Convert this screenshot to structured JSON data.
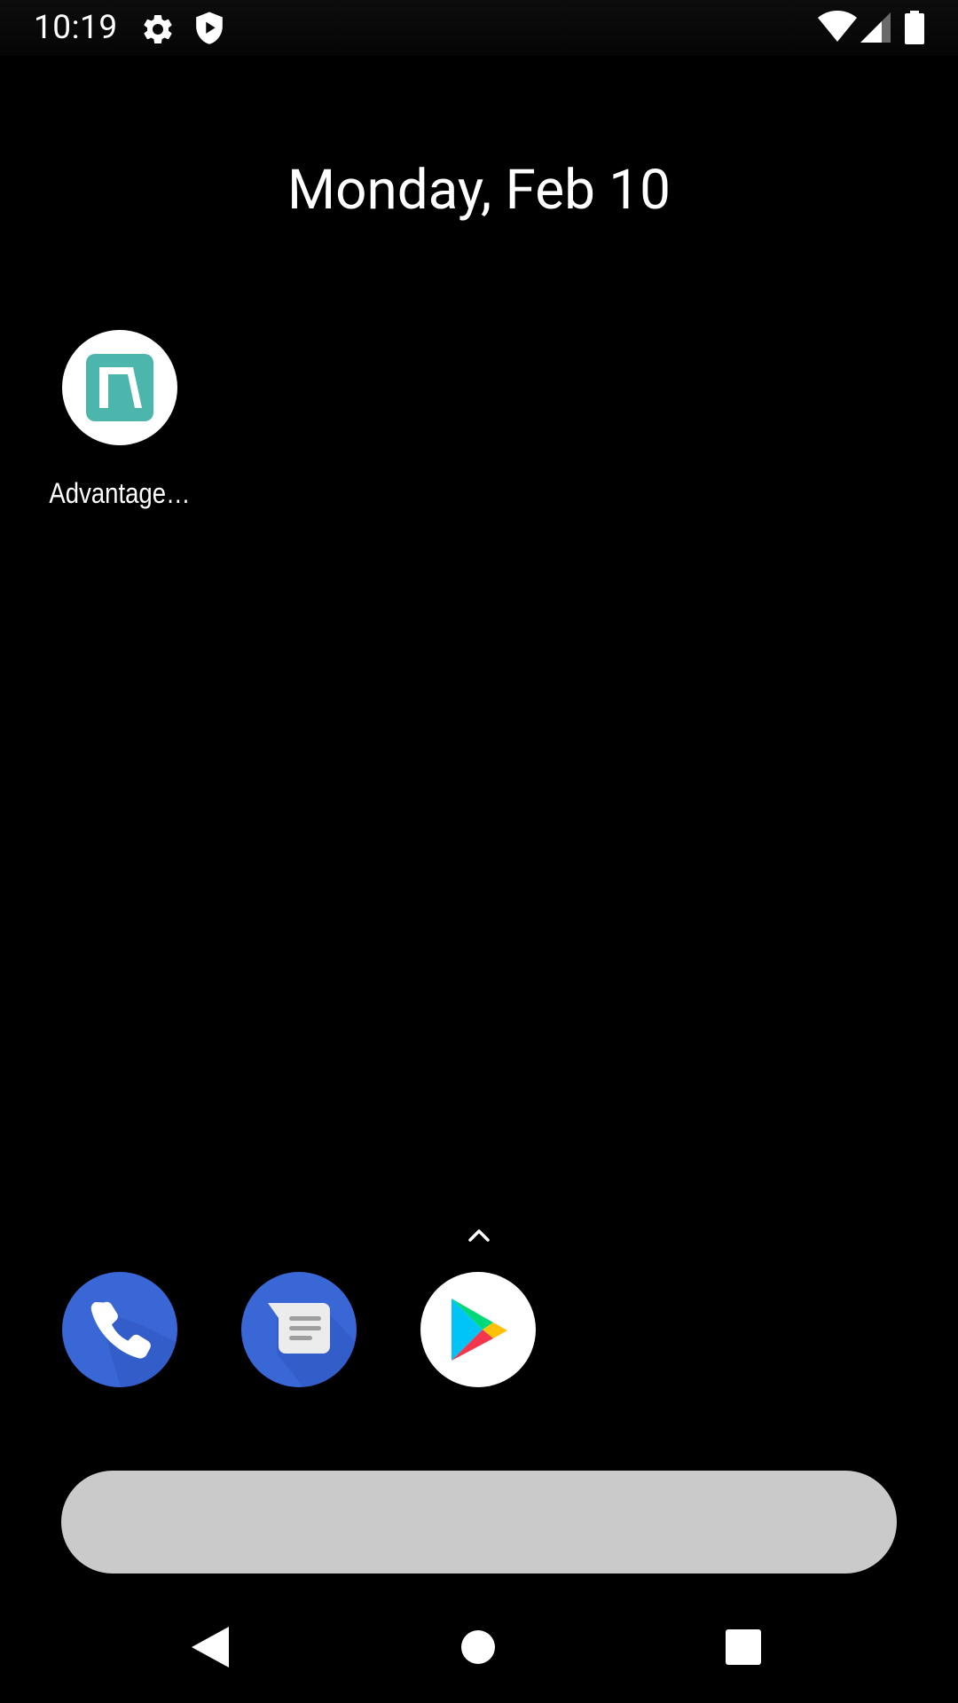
{
  "status_bar": {
    "time": "10:19",
    "left_icons": [
      "gear-icon",
      "shield-play-icon"
    ],
    "right_icons": [
      "wifi-icon",
      "cell-signal-icon",
      "battery-icon"
    ]
  },
  "date_widget": {
    "text": "Monday, Feb 10"
  },
  "home_apps": [
    {
      "label": "Advantage…",
      "icon": "advantage-app-icon",
      "icon_bg": "#4db6ac"
    }
  ],
  "dock_apps": [
    {
      "name": "Phone",
      "icon": "phone-icon",
      "bg": "#3367d6"
    },
    {
      "name": "Messages",
      "icon": "messages-icon",
      "bg": "#3367d6"
    },
    {
      "name": "Play Store",
      "icon": "play-store-icon",
      "bg": "#ffffff"
    }
  ],
  "app_drawer_handle": {
    "icon": "chevron-up-icon"
  },
  "search_bar": {
    "color": "#cacaca"
  },
  "nav_bar": {
    "buttons": [
      "back-icon",
      "home-icon",
      "recents-icon"
    ]
  }
}
